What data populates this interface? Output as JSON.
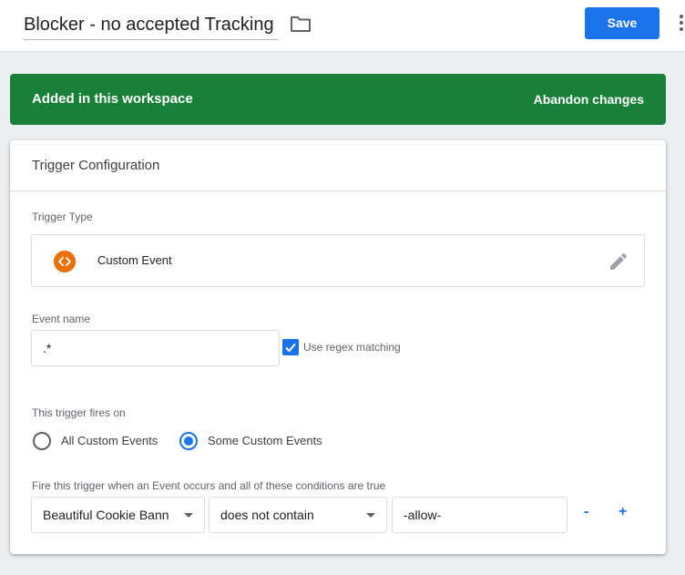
{
  "header": {
    "title": "Blocker - no accepted Tracking",
    "folder_icon": "folder-icon",
    "save_label": "Save",
    "more_icon": "more-vertical-icon"
  },
  "banner": {
    "message": "Added in this workspace",
    "action_label": "Abandon changes",
    "color": "#188038"
  },
  "trigger_config": {
    "title": "Trigger Configuration",
    "trigger_type": {
      "label": "Trigger Type",
      "name": "Custom Event",
      "icon": "custom-event-icon",
      "icon_color": "#e8710a",
      "edit_icon": "pencil-icon"
    },
    "event_name": {
      "label": "Event name",
      "value": ".*",
      "use_regex": true,
      "regex_label": "Use regex matching"
    },
    "fires_on": {
      "label": "This trigger fires on",
      "options": [
        "All Custom Events",
        "Some Custom Events"
      ],
      "selected": "Some Custom Events"
    },
    "condition": {
      "label": "Fire this trigger when an Event occurs and all of these conditions are true",
      "variable": "Beautiful Cookie Banner",
      "operator": "does not contain",
      "value": "-allow-",
      "remove_label": "-",
      "add_label": "+"
    }
  },
  "colors": {
    "accent": "#1a73e8",
    "success": "#188038"
  }
}
